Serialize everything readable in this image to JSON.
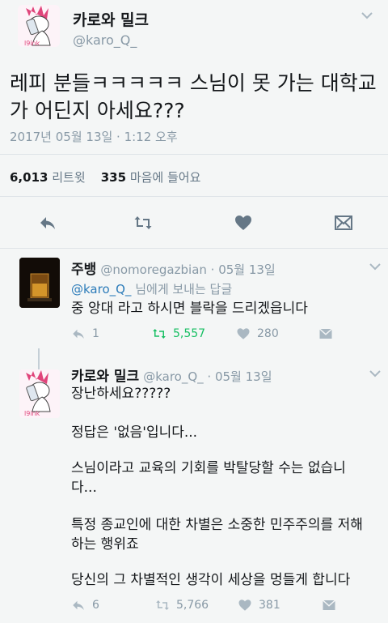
{
  "main_tweet": {
    "display_name": "카로와 밀크",
    "handle": "@karo_Q_",
    "text": "레피 분들ㅋㅋㅋㅋㅋ 스님이 못 가는 대학교가 어딘지 아세요???",
    "timestamp": "2017년 05월 13일 · 1:12 오후",
    "retweets_count": "6,013",
    "retweets_label": "리트윗",
    "likes_count": "335",
    "likes_label": "마음에 들어요"
  },
  "reply1": {
    "display_name": "주뱅",
    "handle_date": "@nomoregazbian · 05월 13일",
    "reply_to_handle": "@karo_Q_",
    "reply_to_suffix": "님에게 보내는 답글",
    "text": "중 앙대 라고 하시면 블락을 드리겠읍니다",
    "reply_count": "1",
    "retweet_count": "5,557",
    "like_count": "280"
  },
  "reply2": {
    "display_name": "카로와 밀크",
    "handle_date": "@karo_Q_ · 05월 13일",
    "line1": "장난하세요?????",
    "line2": "정답은 '없음'입니다...",
    "line3": "스님이라고 교육의 기회를 박탈당할 수는 없습니다...",
    "line4": "특정 종교인에 대한 차별은 소중한 민주주의를 저해하는 행위죠",
    "line5": "당신의 그 차별적인 생각이 세상을 멍들게 합니다",
    "reply_count": "6",
    "retweet_count": "5,766",
    "like_count": "381"
  },
  "icons": [
    "reply-icon",
    "retweet-icon",
    "heart-icon",
    "dm-icon",
    "chevron-down-icon"
  ],
  "colors": {
    "accent": "#2b7bb9",
    "retweet_green": "#17bf63",
    "muted": "#8899a6"
  }
}
